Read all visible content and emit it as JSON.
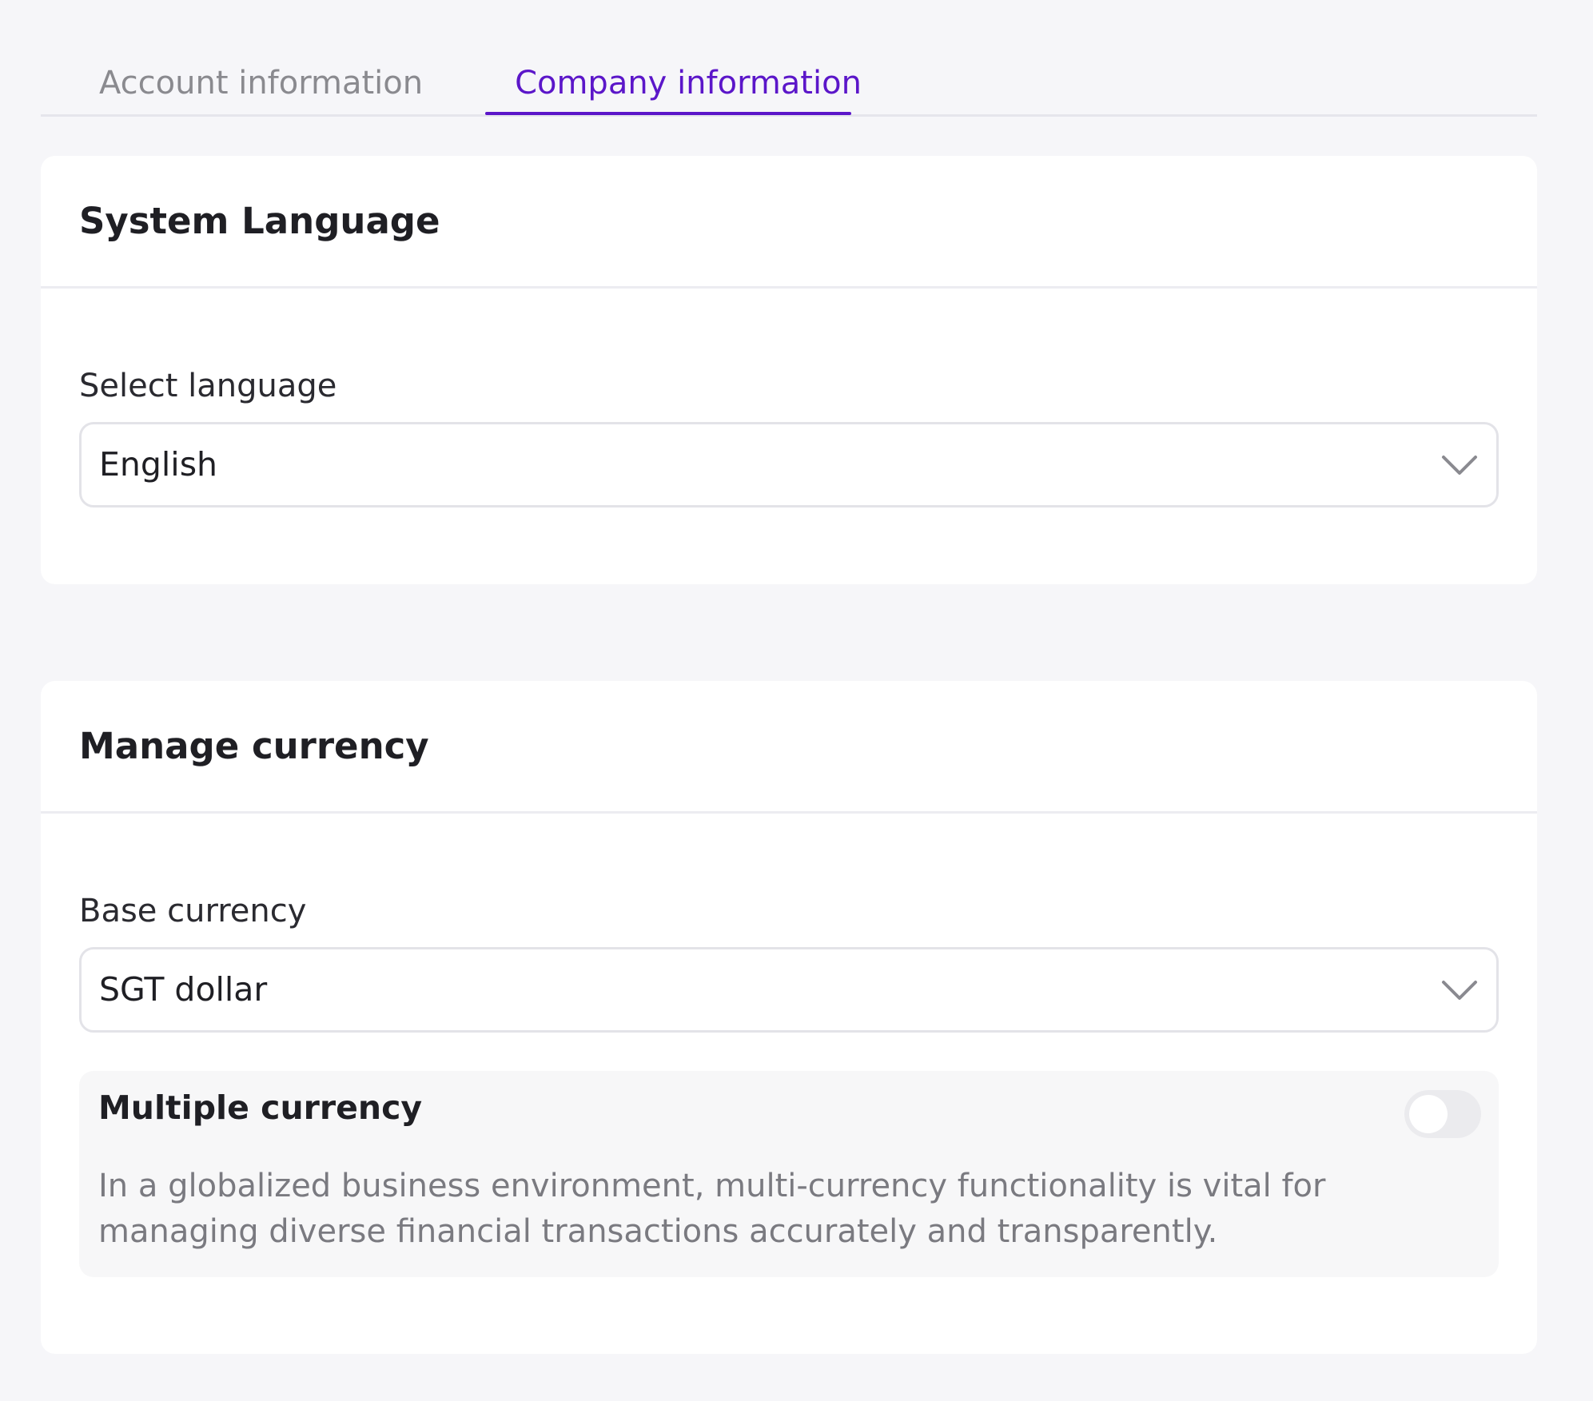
{
  "tabs": {
    "account_label": "Account information",
    "company_label": "Company information",
    "active": "Company information",
    "accent_color": "#5b16c9"
  },
  "language_card": {
    "title": "System Language",
    "field_label": "Select language",
    "selected_value": "English",
    "dropdown_icon": "chevron-down-icon"
  },
  "currency_card": {
    "title": "Manage currency",
    "field_label": "Base currency",
    "selected_value": "SGT dollar",
    "dropdown_icon": "chevron-down-icon",
    "multiple_currency": {
      "title": "Multiple currency",
      "enabled": false,
      "description": "In a globalized business environment, multi-currency functionality is vital for managing diverse financial transactions accurately and transparently."
    }
  }
}
